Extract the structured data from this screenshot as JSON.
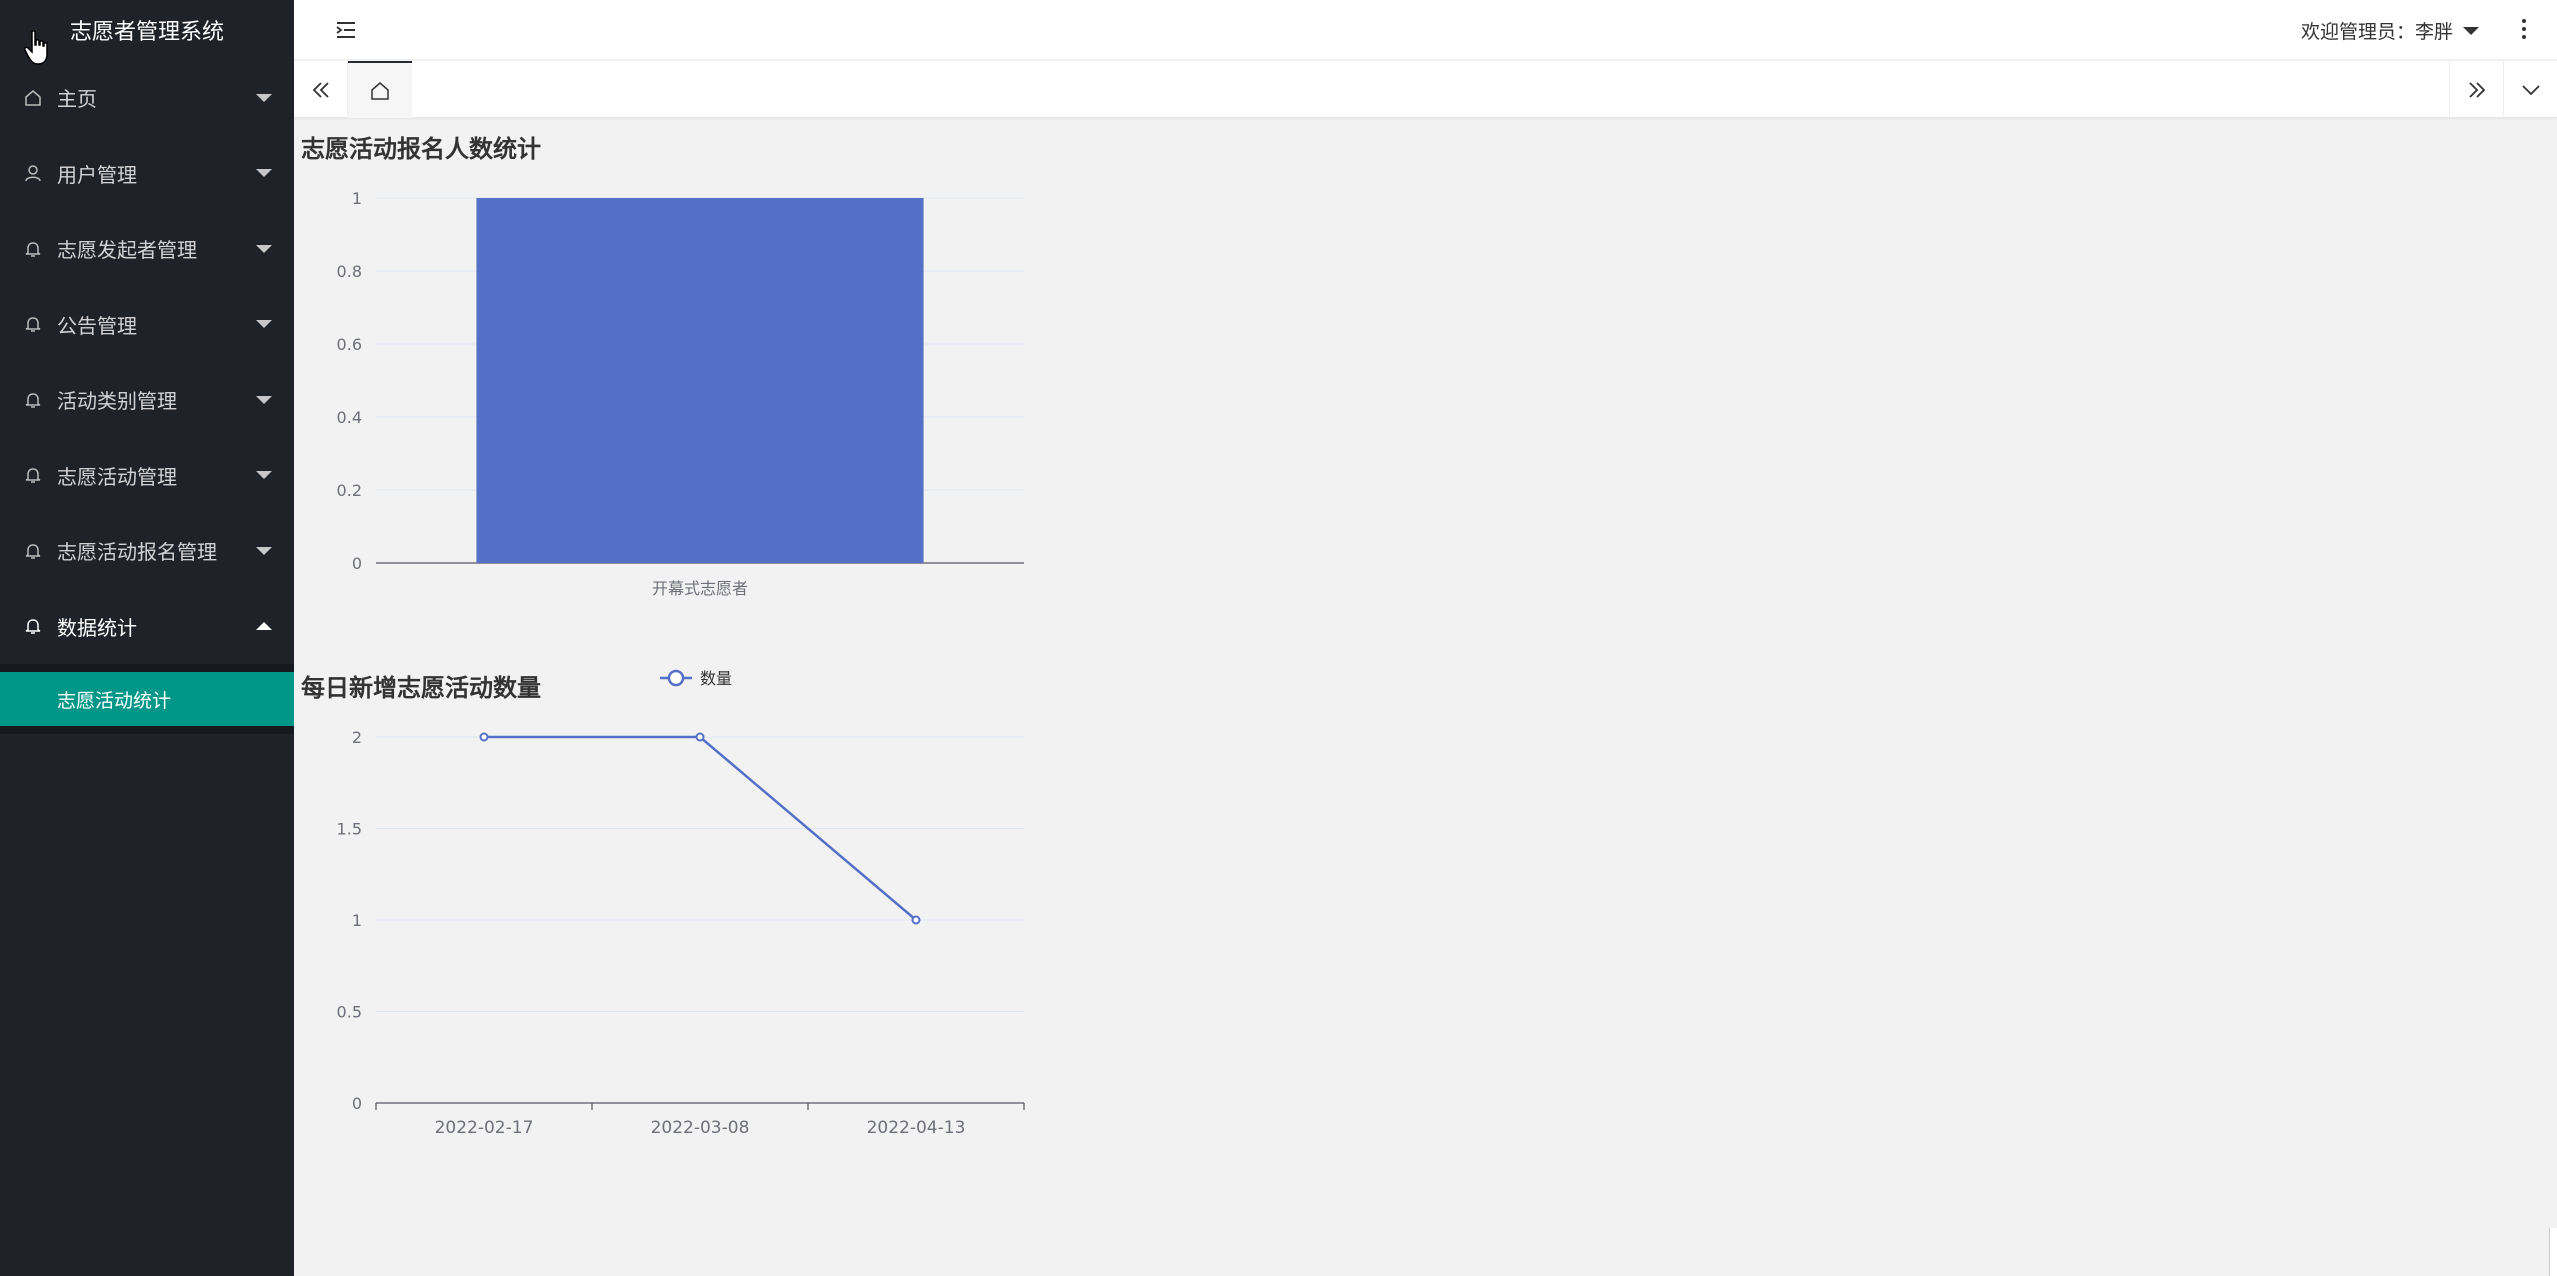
{
  "app": {
    "title": "志愿者管理系统"
  },
  "sidebar": {
    "items": [
      {
        "label": "主页",
        "icon": "home-icon"
      },
      {
        "label": "用户管理",
        "icon": "user-icon"
      },
      {
        "label": "志愿发起者管理",
        "icon": "bell-icon"
      },
      {
        "label": "公告管理",
        "icon": "bell-icon"
      },
      {
        "label": "活动类别管理",
        "icon": "bell-icon"
      },
      {
        "label": "志愿活动管理",
        "icon": "bell-icon"
      },
      {
        "label": "志愿活动报名管理",
        "icon": "bell-icon"
      },
      {
        "label": "数据统计",
        "icon": "bell-icon",
        "expanded": true
      }
    ],
    "sub_items": [
      {
        "label": "志愿活动统计",
        "active": true
      }
    ]
  },
  "header": {
    "welcome": "欢迎管理员：李胖"
  },
  "colors": {
    "sidebar_bg": "#20222a",
    "active_sub": "#009688",
    "series": "#5470c6"
  },
  "chart_data": [
    {
      "type": "bar",
      "title": "志愿活动报名人数统计",
      "categories": [
        "开幕式志愿者"
      ],
      "values": [
        1
      ],
      "ylim": [
        0,
        1
      ],
      "yticks": [
        "0",
        "0.2",
        "0.4",
        "0.6",
        "0.8",
        "1"
      ],
      "grid": true
    },
    {
      "type": "line",
      "title": "每日新增志愿活动数量",
      "categories": [
        "2022-02-17",
        "2022-03-08",
        "2022-04-13"
      ],
      "series": [
        {
          "name": "数量",
          "values": [
            2,
            2,
            1
          ]
        }
      ],
      "ylim": [
        0,
        2
      ],
      "yticks": [
        "0",
        "0.5",
        "1",
        "1.5",
        "2"
      ],
      "legend": "top-center",
      "grid": true
    }
  ]
}
